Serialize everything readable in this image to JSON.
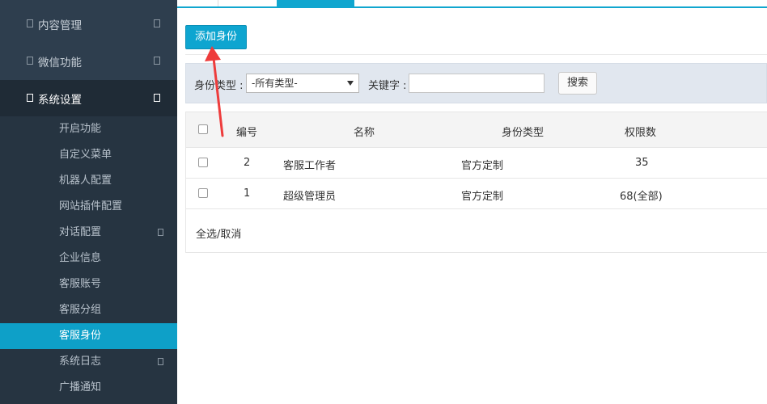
{
  "sidebar": {
    "groups": [
      {
        "label": "内容管理"
      },
      {
        "label": "微信功能"
      },
      {
        "label": "系统设置"
      }
    ],
    "items": [
      {
        "label": "开启功能"
      },
      {
        "label": "自定义菜单"
      },
      {
        "label": "机器人配置"
      },
      {
        "label": "网站插件配置"
      },
      {
        "label": "对话配置"
      },
      {
        "label": "企业信息"
      },
      {
        "label": "客服账号"
      },
      {
        "label": "客服分组"
      },
      {
        "label": "客服身份"
      },
      {
        "label": "系统日志"
      },
      {
        "label": "广播通知"
      }
    ],
    "active_item": "客服身份"
  },
  "toolbar": {
    "add_label": "添加身份"
  },
  "filter": {
    "type_label": "身份类型 :",
    "type_value": "-所有类型-",
    "keyword_label": "关键字 :",
    "keyword_value": "",
    "search_label": "搜索"
  },
  "table": {
    "headers": [
      "编号",
      "名称",
      "身份类型",
      "权限数"
    ],
    "rows": [
      {
        "id": "2",
        "name": "客服工作者",
        "type": "官方定制",
        "perms": "35"
      },
      {
        "id": "1",
        "name": "超级管理员",
        "type": "官方定制",
        "perms": "68(全部)"
      }
    ],
    "footer_label": "全选/取消"
  },
  "colors": {
    "accent": "#0ea5d0",
    "sidebar_bg": "#2e3e4e",
    "annotation_arrow": "#ee3c3c"
  }
}
